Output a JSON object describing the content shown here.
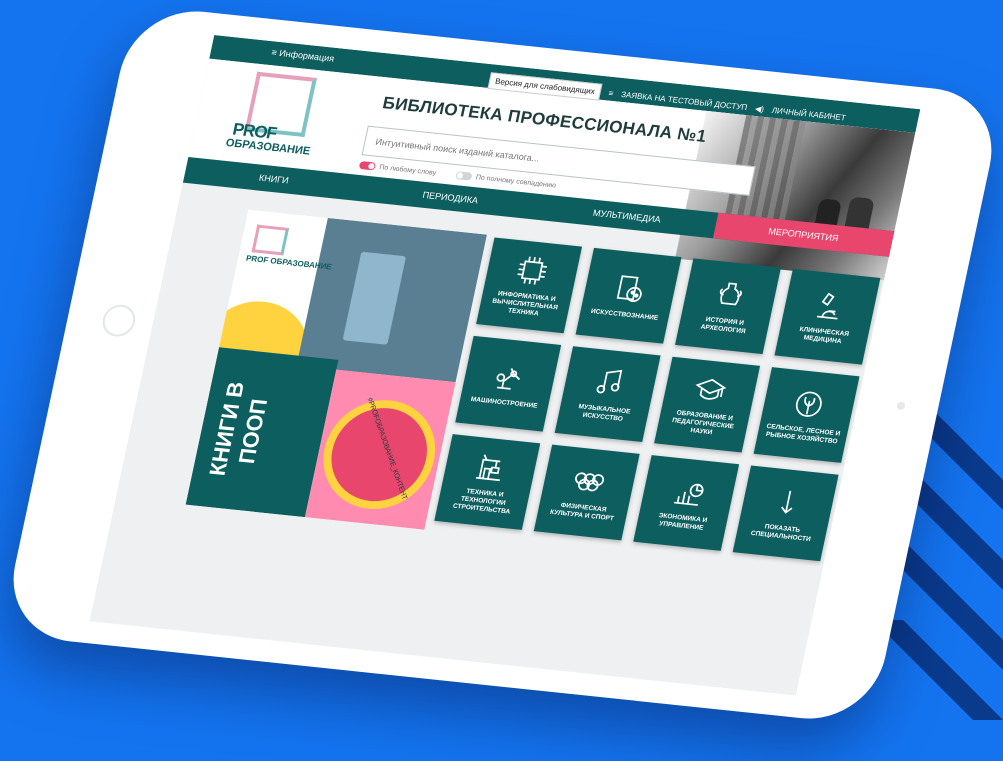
{
  "topbar": {
    "menu_label": "Информация",
    "visually_impaired_label": "Версия для слабовидящих",
    "test_access_label": "ЗАЯВКА НА ТЕСТОВЫЙ ДОСТУП",
    "account_label": "ЛИЧНЫЙ КАБИНЕТ"
  },
  "logo": {
    "line1": "PROF",
    "line2": "ОБРАЗОВАНИЕ"
  },
  "header": {
    "title": "БИБЛИОТЕКА ПРОФЕССИОНАЛА №1"
  },
  "search": {
    "placeholder": "Интуитивный поиск изданий каталога...",
    "toggle_1": "По любому слову",
    "toggle_2": "По полному совпадению"
  },
  "nav": {
    "tabs": [
      {
        "label": "КНИГИ"
      },
      {
        "label": "ПЕРИОДИКА"
      },
      {
        "label": "МУЛЬТИМЕДИА"
      },
      {
        "label": "МЕРОПРИЯТИЯ"
      }
    ]
  },
  "promo": {
    "title": "КНИГИ В ПООП",
    "hashtag": "#PROFОБРАЗОВАНИЕ_КОНТЕНТ",
    "logo_text": "PROF ОБРАЗОВАНИЕ"
  },
  "categories": [
    {
      "label": "ИНФОРМАТИКА И ВЫЧИСЛИТЕЛЬНАЯ ТЕХНИКА",
      "icon": "chip-icon"
    },
    {
      "label": "ИСКУССТВОЗНАНИЕ",
      "icon": "palette-icon"
    },
    {
      "label": "ИСТОРИЯ И АРХЕОЛОГИЯ",
      "icon": "amphora-icon"
    },
    {
      "label": "КЛИНИЧЕСКАЯ МЕДИЦИНА",
      "icon": "microscope-icon"
    },
    {
      "label": "МАШИНОСТРОЕНИЕ",
      "icon": "robot-arm-icon"
    },
    {
      "label": "МУЗЫКАЛЬНОЕ ИСКУССТВО",
      "icon": "music-note-icon"
    },
    {
      "label": "ОБРАЗОВАНИЕ И ПЕДАГОГИЧЕСКИЕ НАУКИ",
      "icon": "graduation-cap-icon"
    },
    {
      "label": "СЕЛЬСКОЕ, ЛЕСНОЕ И РЫБНОЕ ХОЗЯЙСТВО",
      "icon": "leaf-icon"
    },
    {
      "label": "ТЕХНИКА И ТЕХНОЛОГИИ СТРОИТЕЛЬСТВА",
      "icon": "crane-icon"
    },
    {
      "label": "ФИЗИЧЕСКАЯ КУЛЬТУРА И СПОРТ",
      "icon": "olympic-rings-icon"
    },
    {
      "label": "ЭКОНОМИКА И УПРАВЛЕНИЕ",
      "icon": "chart-icon"
    },
    {
      "label": "ПОКАЗАТЬ СПЕЦИАЛЬНОСТИ",
      "icon": "arrow-down-icon"
    }
  ]
}
